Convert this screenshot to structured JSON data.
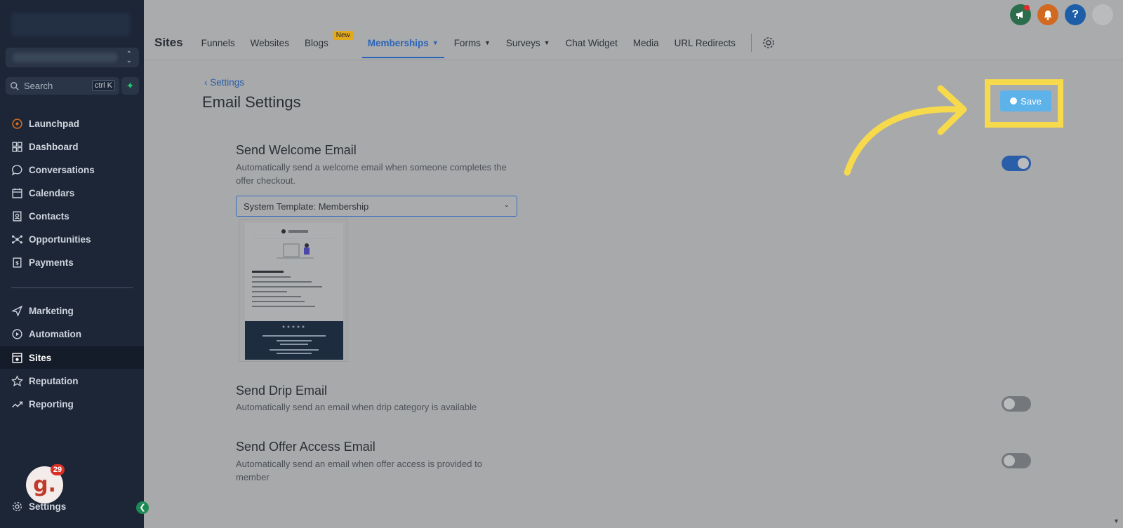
{
  "sidebar": {
    "search_placeholder": "Search",
    "search_shortcut": "ctrl K",
    "items": [
      {
        "label": "Launchpad",
        "icon": "rocket-icon"
      },
      {
        "label": "Dashboard",
        "icon": "grid-icon"
      },
      {
        "label": "Conversations",
        "icon": "chat-icon"
      },
      {
        "label": "Calendars",
        "icon": "calendar-icon"
      },
      {
        "label": "Contacts",
        "icon": "contacts-icon"
      },
      {
        "label": "Opportunities",
        "icon": "network-icon"
      },
      {
        "label": "Payments",
        "icon": "receipt-icon"
      }
    ],
    "items2": [
      {
        "label": "Marketing",
        "icon": "send-icon"
      },
      {
        "label": "Automation",
        "icon": "play-icon"
      },
      {
        "label": "Sites",
        "icon": "site-icon",
        "active": true
      },
      {
        "label": "Reputation",
        "icon": "star-icon"
      },
      {
        "label": "Reporting",
        "icon": "trend-icon"
      }
    ],
    "settings_label": "Settings",
    "notification_count": "29",
    "avatar_letter": "g."
  },
  "topbar": {
    "title": "Sites",
    "tabs": [
      {
        "label": "Funnels"
      },
      {
        "label": "Websites"
      },
      {
        "label": "Blogs",
        "badge": "New"
      },
      {
        "label": "Memberships",
        "active": true,
        "dropdown": true
      },
      {
        "label": "Forms",
        "dropdown": true
      },
      {
        "label": "Surveys",
        "dropdown": true
      },
      {
        "label": "Chat Widget"
      },
      {
        "label": "Media"
      },
      {
        "label": "URL Redirects"
      }
    ],
    "help_label": "?"
  },
  "main": {
    "breadcrumb": "Settings",
    "page_title": "Email Settings",
    "save_label": "Save",
    "welcome": {
      "title": "Send Welcome Email",
      "desc": "Automatically send a welcome email when someone completes the offer checkout.",
      "template": "System Template: Membership",
      "enabled": true
    },
    "drip": {
      "title": "Send Drip Email",
      "desc": "Automatically send an email when drip category is available",
      "enabled": false
    },
    "offer_access": {
      "title": "Send Offer Access Email",
      "desc": "Automatically send an email when offer access is provided to member",
      "enabled": false
    }
  },
  "colors": {
    "sidebar_bg": "#1c2636",
    "accent": "#2a64b8",
    "highlight": "#f7d94c",
    "save_button": "#5db2ea"
  }
}
